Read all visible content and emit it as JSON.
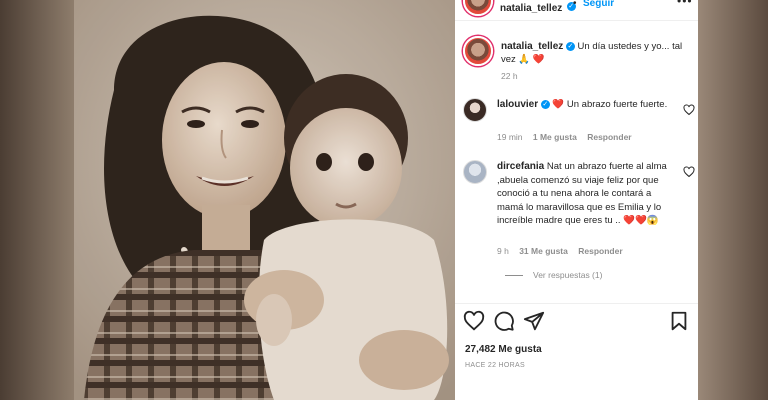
{
  "header": {
    "username": "natalia_tellez",
    "separator": "•",
    "follow_label": "Seguir",
    "more_label": "•••"
  },
  "caption": {
    "username": "natalia_tellez",
    "text": "Un día ustedes y yo... tal vez 🙏 ❤️",
    "time": "22 h"
  },
  "comments": [
    {
      "username": "lalouvier",
      "text": "❤️ Un abrazo fuerte fuerte.",
      "time": "19 min",
      "likes": "1 Me gusta",
      "reply_label": "Responder"
    },
    {
      "username": "dircefania",
      "text": "Nat un abrazo fuerte al alma ,abuela comenzó su viaje feliz por que conoció a tu nena ahora le contará a mamá lo maravillosa que es Emilia y lo increíble madre que eres tu .. ❤️❤️😱",
      "time": "9 h",
      "likes": "31 Me gusta",
      "reply_label": "Responder"
    }
  ],
  "view_replies_label": "Ver respuestas (1)",
  "likes_count": "27,482 Me gusta",
  "posted_ago": "HACE 22 HORAS",
  "colors": {
    "accent": "#0095f6",
    "heart": "#ed4956",
    "text": "#262626",
    "muted": "#8e8e8e"
  }
}
